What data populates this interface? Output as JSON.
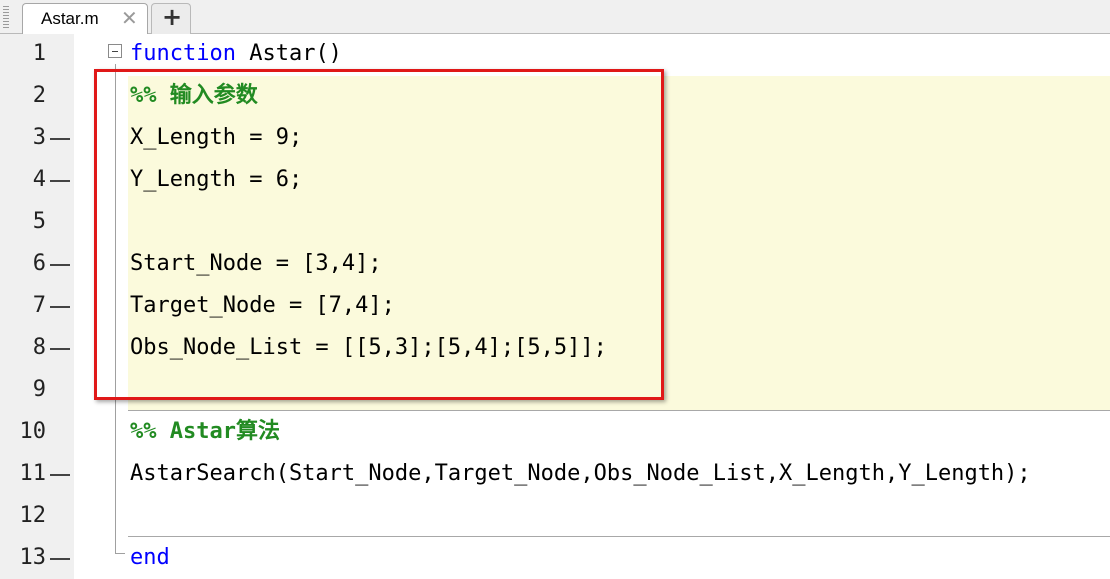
{
  "tabs": [
    {
      "label": "Astar.m",
      "close_glyph": "✕",
      "active": true
    }
  ],
  "add_tab_glyph": "+",
  "editor": {
    "lines": [
      {
        "num": "1",
        "exec": false,
        "segments": [
          {
            "t": "function",
            "c": "kw"
          },
          {
            "t": " Astar()",
            "c": ""
          }
        ]
      },
      {
        "num": "2",
        "exec": false,
        "segments": [
          {
            "t": "%% 输入参数",
            "c": "cm"
          }
        ]
      },
      {
        "num": "3",
        "exec": true,
        "segments": [
          {
            "t": "X_Length = 9;",
            "c": ""
          }
        ]
      },
      {
        "num": "4",
        "exec": true,
        "segments": [
          {
            "t": "Y_Length = 6;",
            "c": ""
          }
        ]
      },
      {
        "num": "5",
        "exec": false,
        "segments": []
      },
      {
        "num": "6",
        "exec": true,
        "segments": [
          {
            "t": "Start_Node = [3,4];",
            "c": ""
          }
        ]
      },
      {
        "num": "7",
        "exec": true,
        "segments": [
          {
            "t": "Target_Node = [7,4];",
            "c": ""
          }
        ]
      },
      {
        "num": "8",
        "exec": true,
        "segments": [
          {
            "t": "Obs_Node_List = [[5,3];[5,4];[5,5]];",
            "c": ""
          }
        ]
      },
      {
        "num": "9",
        "exec": false,
        "segments": []
      },
      {
        "num": "10",
        "exec": false,
        "segments": [
          {
            "t": "%% Astar算法",
            "c": "cm"
          }
        ]
      },
      {
        "num": "11",
        "exec": true,
        "segments": [
          {
            "t": "AstarSearch(Start_Node,Target_Node,Obs_Node_List,X_Length,Y_Length);",
            "c": ""
          }
        ]
      },
      {
        "num": "12",
        "exec": false,
        "segments": []
      },
      {
        "num": "13",
        "exec": true,
        "segments": [
          {
            "t": "end",
            "c": "kw"
          }
        ]
      }
    ]
  },
  "colors": {
    "keyword": "#0000ff",
    "comment": "#228b22",
    "cell_highlight": "#fbfadc",
    "annotation_box": "#e01818"
  }
}
